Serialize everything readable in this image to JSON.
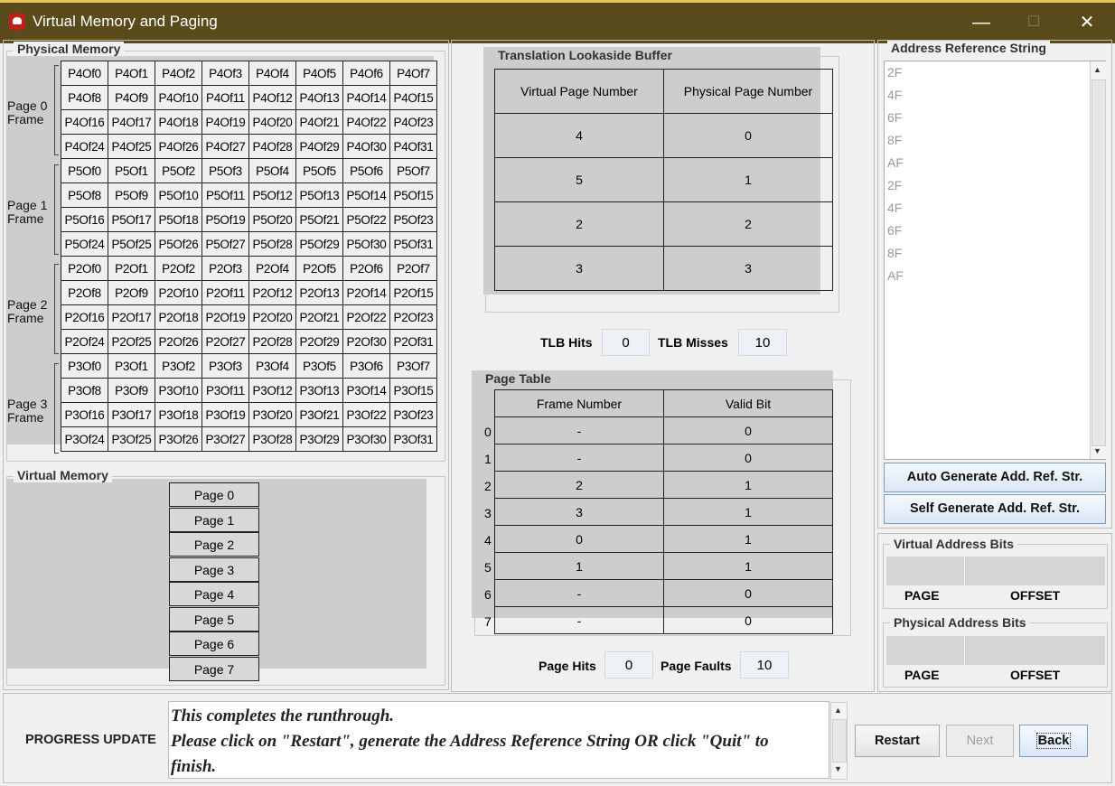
{
  "window": {
    "title": "Virtual Memory and Paging",
    "minimize": "—",
    "maximize": "☐",
    "close": "✕"
  },
  "physical_memory": {
    "legend": "Physical Memory",
    "frames": [
      {
        "label": "Page 0",
        "label2": "Frame",
        "cells": [
          "P4Of0",
          "P4Of1",
          "P4Of2",
          "P4Of3",
          "P4Of4",
          "P4Of5",
          "P4Of6",
          "P4Of7",
          "P4Of8",
          "P4Of9",
          "P4Of10",
          "P4Of11",
          "P4Of12",
          "P4Of13",
          "P4Of14",
          "P4Of15",
          "P4Of16",
          "P4Of17",
          "P4Of18",
          "P4Of19",
          "P4Of20",
          "P4Of21",
          "P4Of22",
          "P4Of23",
          "P4Of24",
          "P4Of25",
          "P4Of26",
          "P4Of27",
          "P4Of28",
          "P4Of29",
          "P4Of30",
          "P4Of31"
        ]
      },
      {
        "label": "Page 1",
        "label2": "Frame",
        "cells": [
          "P5Of0",
          "P5Of1",
          "P5Of2",
          "P5Of3",
          "P5Of4",
          "P5Of5",
          "P5Of6",
          "P5Of7",
          "P5Of8",
          "P5Of9",
          "P5Of10",
          "P5Of11",
          "P5Of12",
          "P5Of13",
          "P5Of14",
          "P5Of15",
          "P5Of16",
          "P5Of17",
          "P5Of18",
          "P5Of19",
          "P5Of20",
          "P5Of21",
          "P5Of22",
          "P5Of23",
          "P5Of24",
          "P5Of25",
          "P5Of26",
          "P5Of27",
          "P5Of28",
          "P5Of29",
          "P5Of30",
          "P5Of31"
        ]
      },
      {
        "label": "Page 2",
        "label2": "Frame",
        "cells": [
          "P2Of0",
          "P2Of1",
          "P2Of2",
          "P2Of3",
          "P2Of4",
          "P2Of5",
          "P2Of6",
          "P2Of7",
          "P2Of8",
          "P2Of9",
          "P2Of10",
          "P2Of11",
          "P2Of12",
          "P2Of13",
          "P2Of14",
          "P2Of15",
          "P2Of16",
          "P2Of17",
          "P2Of18",
          "P2Of19",
          "P2Of20",
          "P2Of21",
          "P2Of22",
          "P2Of23",
          "P2Of24",
          "P2Of25",
          "P2Of26",
          "P2Of27",
          "P2Of28",
          "P2Of29",
          "P2Of30",
          "P2Of31"
        ]
      },
      {
        "label": "Page 3",
        "label2": "Frame",
        "cells": [
          "P3Of0",
          "P3Of1",
          "P3Of2",
          "P3Of3",
          "P3Of4",
          "P3Of5",
          "P3Of6",
          "P3Of7",
          "P3Of8",
          "P3Of9",
          "P3Of10",
          "P3Of11",
          "P3Of12",
          "P3Of13",
          "P3Of14",
          "P3Of15",
          "P3Of16",
          "P3Of17",
          "P3Of18",
          "P3Of19",
          "P3Of20",
          "P3Of21",
          "P3Of22",
          "P3Of23",
          "P3Of24",
          "P3Of25",
          "P3Of26",
          "P3Of27",
          "P3Of28",
          "P3Of29",
          "P3Of30",
          "P3Of31"
        ]
      }
    ]
  },
  "virtual_memory": {
    "legend": "Virtual Memory",
    "pages": [
      "Page 0",
      "Page 1",
      "Page 2",
      "Page 3",
      "Page 4",
      "Page 5",
      "Page 6",
      "Page 7"
    ]
  },
  "tlb": {
    "legend": "Translation Lookaside Buffer",
    "headers": [
      "Virtual Page Number",
      "Physical Page Number"
    ],
    "rows": [
      [
        "4",
        "0"
      ],
      [
        "5",
        "1"
      ],
      [
        "2",
        "2"
      ],
      [
        "3",
        "3"
      ]
    ],
    "hits_label": "TLB Hits",
    "hits": "0",
    "misses_label": "TLB Misses",
    "misses": "10"
  },
  "page_table": {
    "legend": "Page Table",
    "headers": [
      "Frame Number",
      "Valid Bit"
    ],
    "rows": [
      {
        "index": "0",
        "frame": "-",
        "valid": "0"
      },
      {
        "index": "1",
        "frame": "-",
        "valid": "0"
      },
      {
        "index": "2",
        "frame": "2",
        "valid": "1"
      },
      {
        "index": "3",
        "frame": "3",
        "valid": "1"
      },
      {
        "index": "4",
        "frame": "0",
        "valid": "1"
      },
      {
        "index": "5",
        "frame": "1",
        "valid": "1"
      },
      {
        "index": "6",
        "frame": "-",
        "valid": "0"
      },
      {
        "index": "7",
        "frame": "-",
        "valid": "0"
      }
    ],
    "hits_label": "Page Hits",
    "hits": "0",
    "faults_label": "Page Faults",
    "faults": "10"
  },
  "address_reference": {
    "legend": "Address Reference String",
    "items": [
      "2F",
      "4F",
      "6F",
      "8F",
      "AF",
      "2F",
      "4F",
      "6F",
      "8F",
      "AF"
    ],
    "auto_button": "Auto Generate Add. Ref. Str.",
    "self_button": "Self Generate Add. Ref. Str."
  },
  "virtual_bits": {
    "legend": "Virtual Address Bits",
    "page": "PAGE",
    "offset": "OFFSET"
  },
  "physical_bits": {
    "legend": "Physical Address Bits",
    "page": "PAGE",
    "offset": "OFFSET"
  },
  "progress": {
    "label": "PROGRESS UPDATE",
    "line1": "This completes the runthrough.",
    "line2": "Please click on \"Restart\", generate the Address Reference String OR click \"Quit\" to",
    "line3": "finish."
  },
  "buttons": {
    "restart": "Restart",
    "next": "Next",
    "back": "Back"
  }
}
